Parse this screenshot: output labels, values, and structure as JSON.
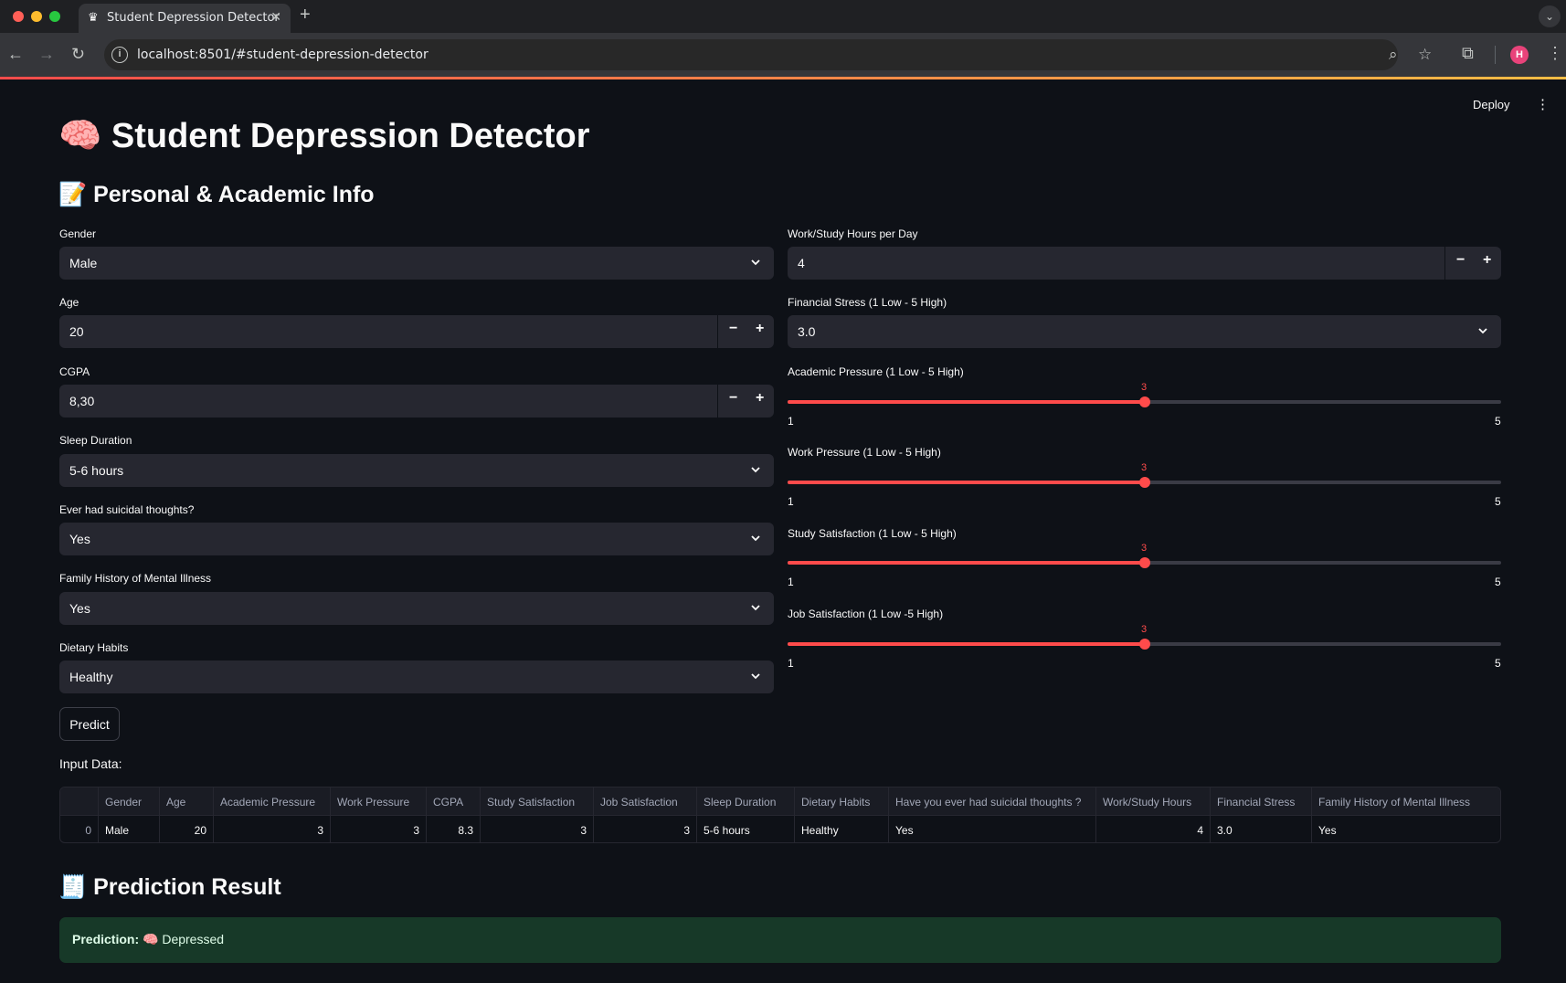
{
  "browser": {
    "tab_title": "Student Depression Detector",
    "tab_icon": "crown-icon",
    "url": "localhost:8501/#student-depression-detector",
    "avatar_initial": "H"
  },
  "app": {
    "deploy_label": "Deploy",
    "title": "🧠 Student Depression Detector",
    "section_title": "📝 Personal & Academic Info",
    "left": {
      "gender": {
        "label": "Gender",
        "value": "Male"
      },
      "age": {
        "label": "Age",
        "value": "20"
      },
      "cgpa": {
        "label": "CGPA",
        "value": "8,30"
      },
      "sleep": {
        "label": "Sleep Duration",
        "value": "5-6 hours"
      },
      "suicidal": {
        "label": "Ever had suicidal thoughts?",
        "value": "Yes"
      },
      "family": {
        "label": "Family History of Mental Illness",
        "value": "Yes"
      },
      "diet": {
        "label": "Dietary Habits",
        "value": "Healthy"
      }
    },
    "right": {
      "hours": {
        "label": "Work/Study Hours per Day",
        "value": "4"
      },
      "financial": {
        "label": "Financial Stress (1 Low - 5 High)",
        "value": "3.0"
      },
      "sliders": [
        {
          "label": "Academic Pressure (1 Low - 5 High)",
          "value": 3,
          "min": 1,
          "max": 5
        },
        {
          "label": "Work Pressure (1 Low - 5 High)",
          "value": 3,
          "min": 1,
          "max": 5
        },
        {
          "label": "Study Satisfaction (1 Low - 5 High)",
          "value": 3,
          "min": 1,
          "max": 5
        },
        {
          "label": "Job Satisfaction (1 Low -5 High)",
          "value": 3,
          "min": 1,
          "max": 5
        }
      ]
    },
    "predict_label": "Predict",
    "input_data_label": "Input Data:",
    "table": {
      "columns": [
        "",
        "Gender",
        "Age",
        "Academic Pressure",
        "Work Pressure",
        "CGPA",
        "Study Satisfaction",
        "Job Satisfaction",
        "Sleep Duration",
        "Dietary Habits",
        "Have you ever had suicidal thoughts ?",
        "Work/Study Hours",
        "Financial Stress",
        "Family History of Mental Illness"
      ],
      "rows": [
        [
          "0",
          "Male",
          "20",
          "3",
          "3",
          "8.3",
          "3",
          "3",
          "5-6 hours",
          "Healthy",
          "Yes",
          "4",
          "3.0",
          "Yes"
        ]
      ]
    },
    "result_title": "🧾 Prediction Result",
    "result_label": "Prediction:",
    "result_value": "🧠 Depressed",
    "colors": {
      "accent": "#ff4b4b",
      "success_bg": "#173928",
      "widget_bg": "#262730",
      "page_bg": "#0e1117"
    }
  }
}
